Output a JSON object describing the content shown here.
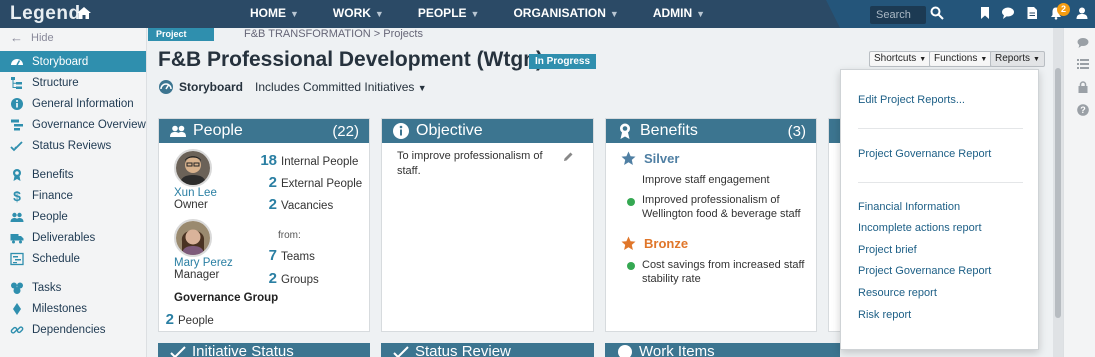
{
  "app": {
    "logo": "Legend",
    "nav": [
      "HOME",
      "WORK",
      "PEOPLE",
      "ORGANISATION",
      "ADMIN"
    ],
    "search_placeholder": "Search",
    "notification_count": "2"
  },
  "sidebar": {
    "hide_label": "Hide",
    "items": [
      {
        "label": "Storyboard",
        "icon": "dashboard-icon"
      },
      {
        "label": "Structure",
        "icon": "structure-icon"
      },
      {
        "label": "General Information",
        "icon": "info-icon"
      },
      {
        "label": "Governance Overview",
        "icon": "governance-icon"
      },
      {
        "label": "Status Reviews",
        "icon": "check-icon"
      },
      {
        "label": "Benefits",
        "icon": "ribbon-icon"
      },
      {
        "label": "Finance",
        "icon": "dollar-icon"
      },
      {
        "label": "People",
        "icon": "people-icon"
      },
      {
        "label": "Deliverables",
        "icon": "truck-icon"
      },
      {
        "label": "Schedule",
        "icon": "schedule-icon"
      },
      {
        "label": "Tasks",
        "icon": "tasks-icon"
      },
      {
        "label": "Milestones",
        "icon": "milestone-icon"
      },
      {
        "label": "Dependencies",
        "icon": "link-icon"
      }
    ]
  },
  "page": {
    "tag": "Project",
    "breadcrumb": "F&B TRANSFORMATION > Projects",
    "title": "F&B Professional Development (Wtgn)",
    "status": "In Progress",
    "view": "Storyboard",
    "filter": "Includes Committed Initiatives",
    "buttons": {
      "shortcuts": "Shortcuts",
      "functions": "Functions",
      "reports": "Reports"
    }
  },
  "people_card": {
    "title": "People",
    "count": "(22)",
    "persons": [
      {
        "name": "Xun Lee",
        "role": "Owner"
      },
      {
        "name": "Mary Perez",
        "role": "Manager"
      }
    ],
    "stats": [
      {
        "num": "18",
        "label": "Internal People"
      },
      {
        "num": "2",
        "label": "External People"
      },
      {
        "num": "2",
        "label": "Vacancies"
      }
    ],
    "from_label": "from:",
    "from_stats": [
      {
        "num": "7",
        "label": "Teams"
      },
      {
        "num": "2",
        "label": "Groups"
      }
    ],
    "governance_title": "Governance Group",
    "governance_stat": {
      "num": "2",
      "label": "People"
    }
  },
  "objective_card": {
    "title": "Objective",
    "text": "To improve professionalism of staff."
  },
  "benefits_card": {
    "title": "Benefits",
    "count": "(3)",
    "tiers": [
      {
        "name": "Silver",
        "color": "#4f7fa3",
        "lead": "Improve staff engagement",
        "items": [
          "Improved professionalism of Wellington food & beverage staff"
        ]
      },
      {
        "name": "Bronze",
        "color": "#e0762a",
        "items": [
          "Cost savings from increased staff stability rate"
        ]
      }
    ]
  },
  "bottom_cards": [
    "Initiative Status",
    "Status Review",
    "Work Items"
  ],
  "reports_menu": {
    "group1": [
      "Edit Project Reports..."
    ],
    "group2": [
      "Project Governance Report"
    ],
    "group3": [
      "Financial Information",
      "Incomplete actions report",
      "Project brief",
      "Project Governance Report",
      "Resource report",
      "Risk report"
    ]
  },
  "colors": {
    "topbar": "#2b4a66",
    "accent": "#2f8fae",
    "card_header": "#3c7590",
    "link": "#2a7fa3"
  }
}
